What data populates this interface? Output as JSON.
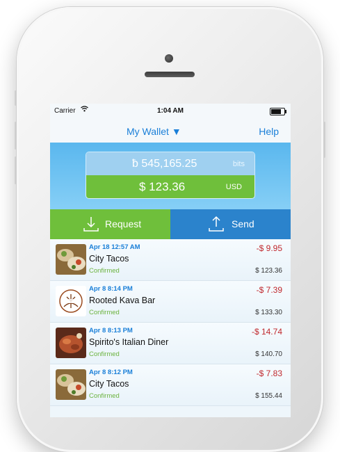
{
  "status_bar": {
    "carrier": "Carrier",
    "time": "1:04 AM"
  },
  "nav": {
    "title": "My Wallet ▼",
    "help": "Help"
  },
  "balance": {
    "bits_amount": "ƀ  545,165.25",
    "bits_unit": "bits",
    "usd_amount": "$  123.36",
    "usd_unit": "USD"
  },
  "actions": {
    "request": "Request",
    "send": "Send"
  },
  "transactions": [
    {
      "date": "Apr 18 12:57 AM",
      "name": "City Tacos",
      "status": "Confirmed",
      "amount": "-$ 9.95",
      "balance": "$  123.36"
    },
    {
      "date": "Apr 8  8:14 PM",
      "name": "Rooted Kava Bar",
      "status": "Confirmed",
      "amount": "-$ 7.39",
      "balance": "$  133.30"
    },
    {
      "date": "Apr 8  8:13 PM",
      "name": "Spirito's Italian Diner",
      "status": "Confirmed",
      "amount": "-$ 14.74",
      "balance": "$  140.70"
    },
    {
      "date": "Apr 8  8:12 PM",
      "name": "City Tacos",
      "status": "Confirmed",
      "amount": "-$ 7.83",
      "balance": "$  155.44"
    }
  ],
  "colors": {
    "accent_blue": "#1a7fd8",
    "green": "#6fbf3b",
    "send_blue": "#2b83cc",
    "negative_red": "#c0282d"
  }
}
